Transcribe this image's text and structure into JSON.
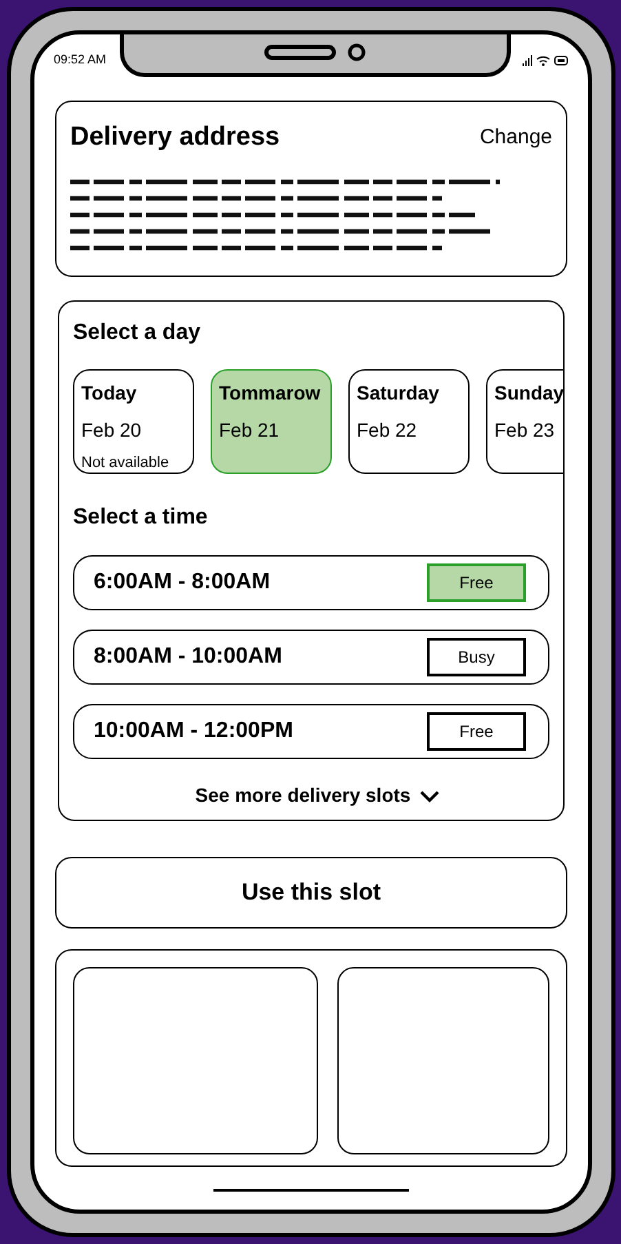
{
  "status_bar": {
    "time": "09:52 AM"
  },
  "address": {
    "title": "Delivery address",
    "action": "Change"
  },
  "day_picker": {
    "title": "Select a day",
    "days": [
      {
        "label": "Today",
        "date": "Feb 20",
        "note": "Not available",
        "selected": false
      },
      {
        "label": "Tommarow",
        "date": "Feb 21",
        "selected": true
      },
      {
        "label": "Saturday",
        "date": "Feb 22",
        "selected": false
      },
      {
        "label": "Sunday",
        "date": "Feb 23",
        "selected": false
      }
    ]
  },
  "time_picker": {
    "title": "Select a time",
    "slots": [
      {
        "time": "6:00AM - 8:00AM",
        "status": "Free",
        "selected": true
      },
      {
        "time": "8:00AM - 10:00AM",
        "status": "Busy",
        "selected": false
      },
      {
        "time": "10:00AM - 12:00PM",
        "status": "Free",
        "selected": false
      }
    ]
  },
  "more_link": "See more delivery slots",
  "primary_button": "Use this slot"
}
